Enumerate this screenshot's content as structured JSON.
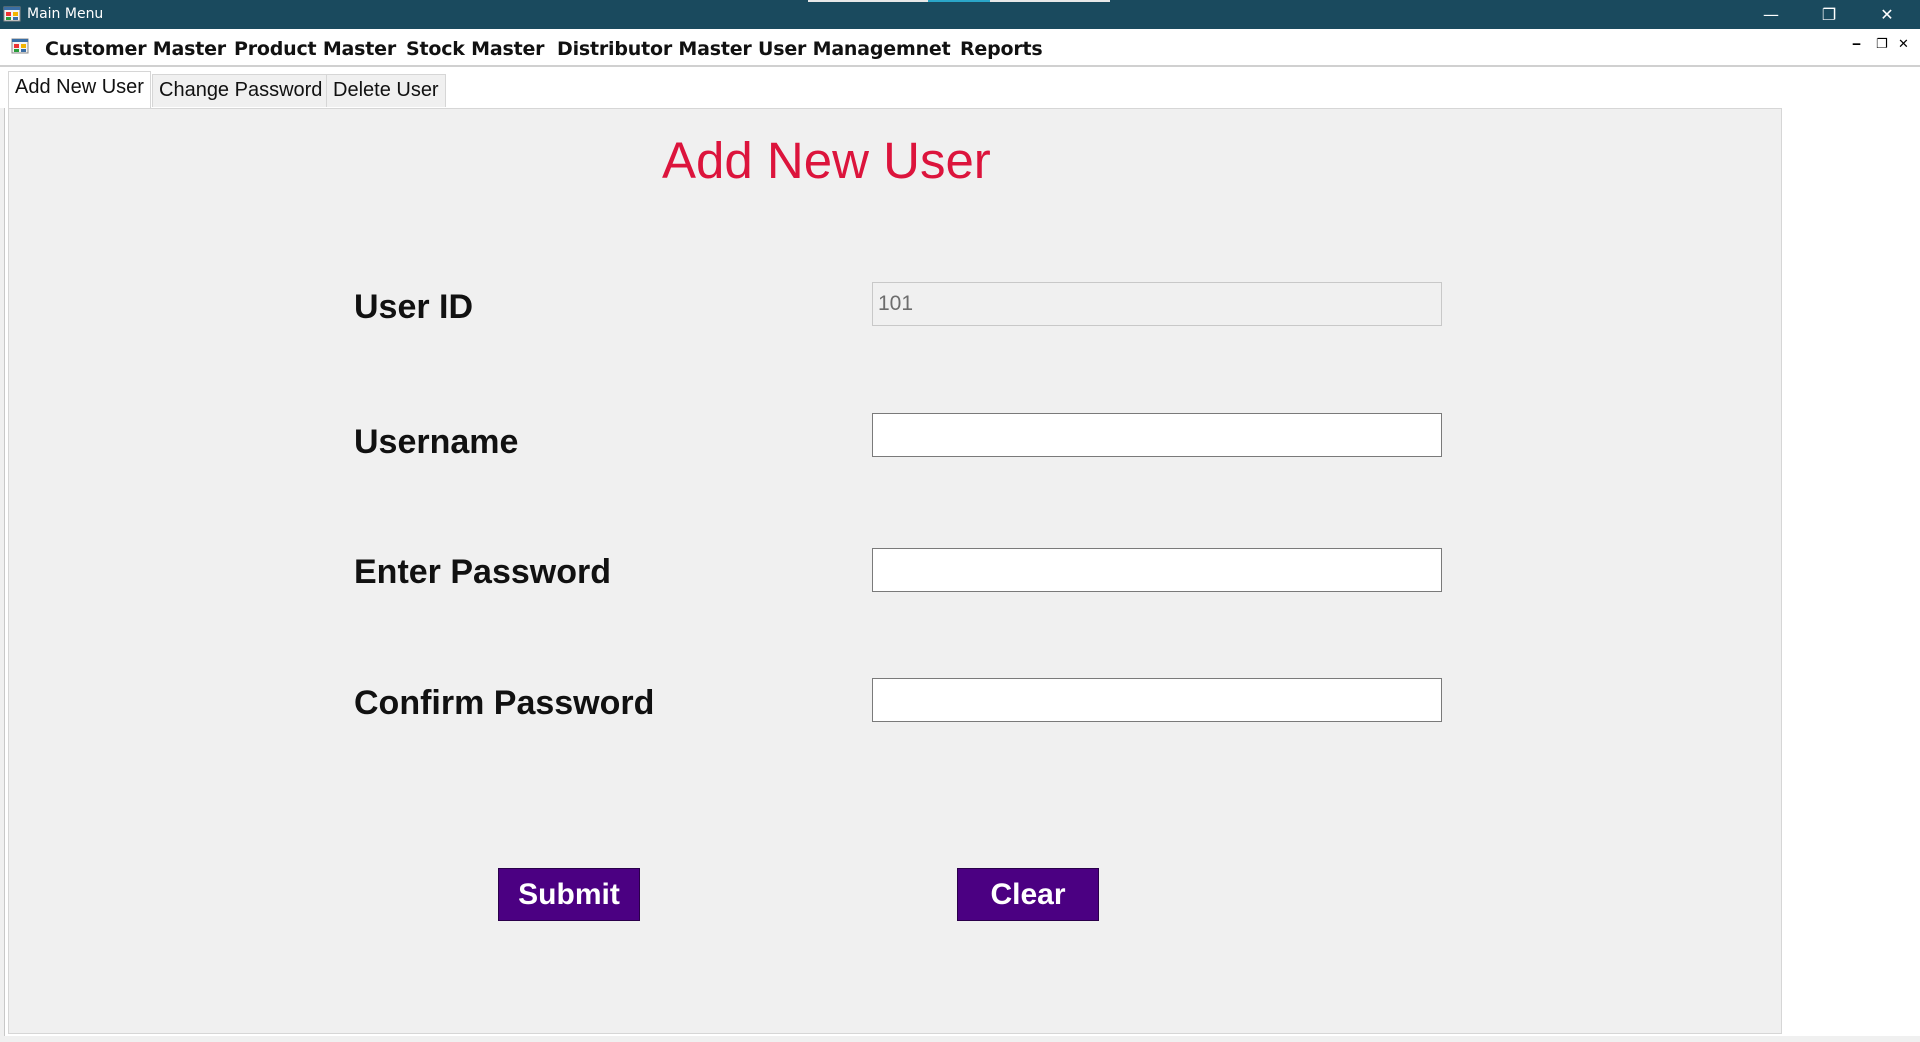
{
  "window": {
    "title": "Main Menu",
    "minimize_glyph": "—",
    "maximize_glyph": "❐",
    "close_glyph": "✕",
    "icon": "app-window-icon"
  },
  "menu": {
    "items": [
      "Customer Master",
      "Product Master",
      "Stock Master",
      "Distributor Master",
      "User Managemnet",
      "Reports"
    ],
    "mdi_minimize": "‒",
    "mdi_restore": "❐",
    "mdi_close": "✕",
    "icon": "mdi-form-icon"
  },
  "tabs": [
    "Add New User",
    "Change Password",
    "Delete User"
  ],
  "form": {
    "heading": "Add New User",
    "user_id_label": "User ID",
    "user_id_value": "101",
    "username_label": "Username",
    "username_value": "",
    "enter_password_label": "Enter Password",
    "enter_password_value": "",
    "confirm_password_label": "Confirm Password",
    "confirm_password_value": "",
    "submit_label": "Submit",
    "clear_label": "Clear"
  },
  "colors": {
    "titlebar": "#1a4a5e",
    "heading": "#dc143c",
    "button": "#4b0082"
  }
}
